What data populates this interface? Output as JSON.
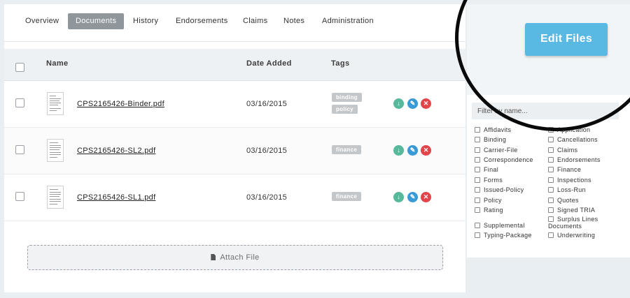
{
  "tabs": [
    {
      "label": "Overview"
    },
    {
      "label": "Documents",
      "active": true
    },
    {
      "label": "History"
    },
    {
      "label": "Endorsements"
    },
    {
      "label": "Claims"
    },
    {
      "label": "Notes"
    },
    {
      "label": "Administration"
    }
  ],
  "table": {
    "headers": {
      "name": "Name",
      "date": "Date Added",
      "tags": "Tags"
    },
    "rows": [
      {
        "name": "CPS2165426-Binder.pdf",
        "date": "03/16/2015",
        "tags": [
          "binding",
          "policy"
        ]
      },
      {
        "name": "CPS2165426-SL2.pdf",
        "date": "03/16/2015",
        "tags": [
          "finance"
        ]
      },
      {
        "name": "CPS2165426-SL1.pdf",
        "date": "03/16/2015",
        "tags": [
          "finance"
        ]
      }
    ],
    "actions": {
      "download_icon": "download-icon",
      "edit_icon": "pencil-icon",
      "delete_icon": "close-icon"
    }
  },
  "attach": {
    "label": "Attach File",
    "icon": "file-icon"
  },
  "edit_button": {
    "label": "Edit Files"
  },
  "filter": {
    "placeholder": "Filter by name...",
    "left_options": [
      "Affidavits",
      "Binding",
      "Carrier-File",
      "Correspondence",
      "Final",
      "Forms",
      "Issued-Policy",
      "Policy",
      "Rating",
      "Supplemental",
      "Typing-Package"
    ],
    "right_options": [
      "Application",
      "Cancellations",
      "Claims",
      "Endorsements",
      "Finance",
      "Inspections",
      "Loss-Run",
      "Quotes",
      "Signed TRIA",
      "Surplus Lines Documents",
      "Underwriting"
    ]
  },
  "colors": {
    "accent": "#59b9e3",
    "active_tab": "#8f969c",
    "download": "#57b99b",
    "edit": "#3a9ad6",
    "delete": "#e0454a",
    "tag": "#c4c7ca"
  }
}
